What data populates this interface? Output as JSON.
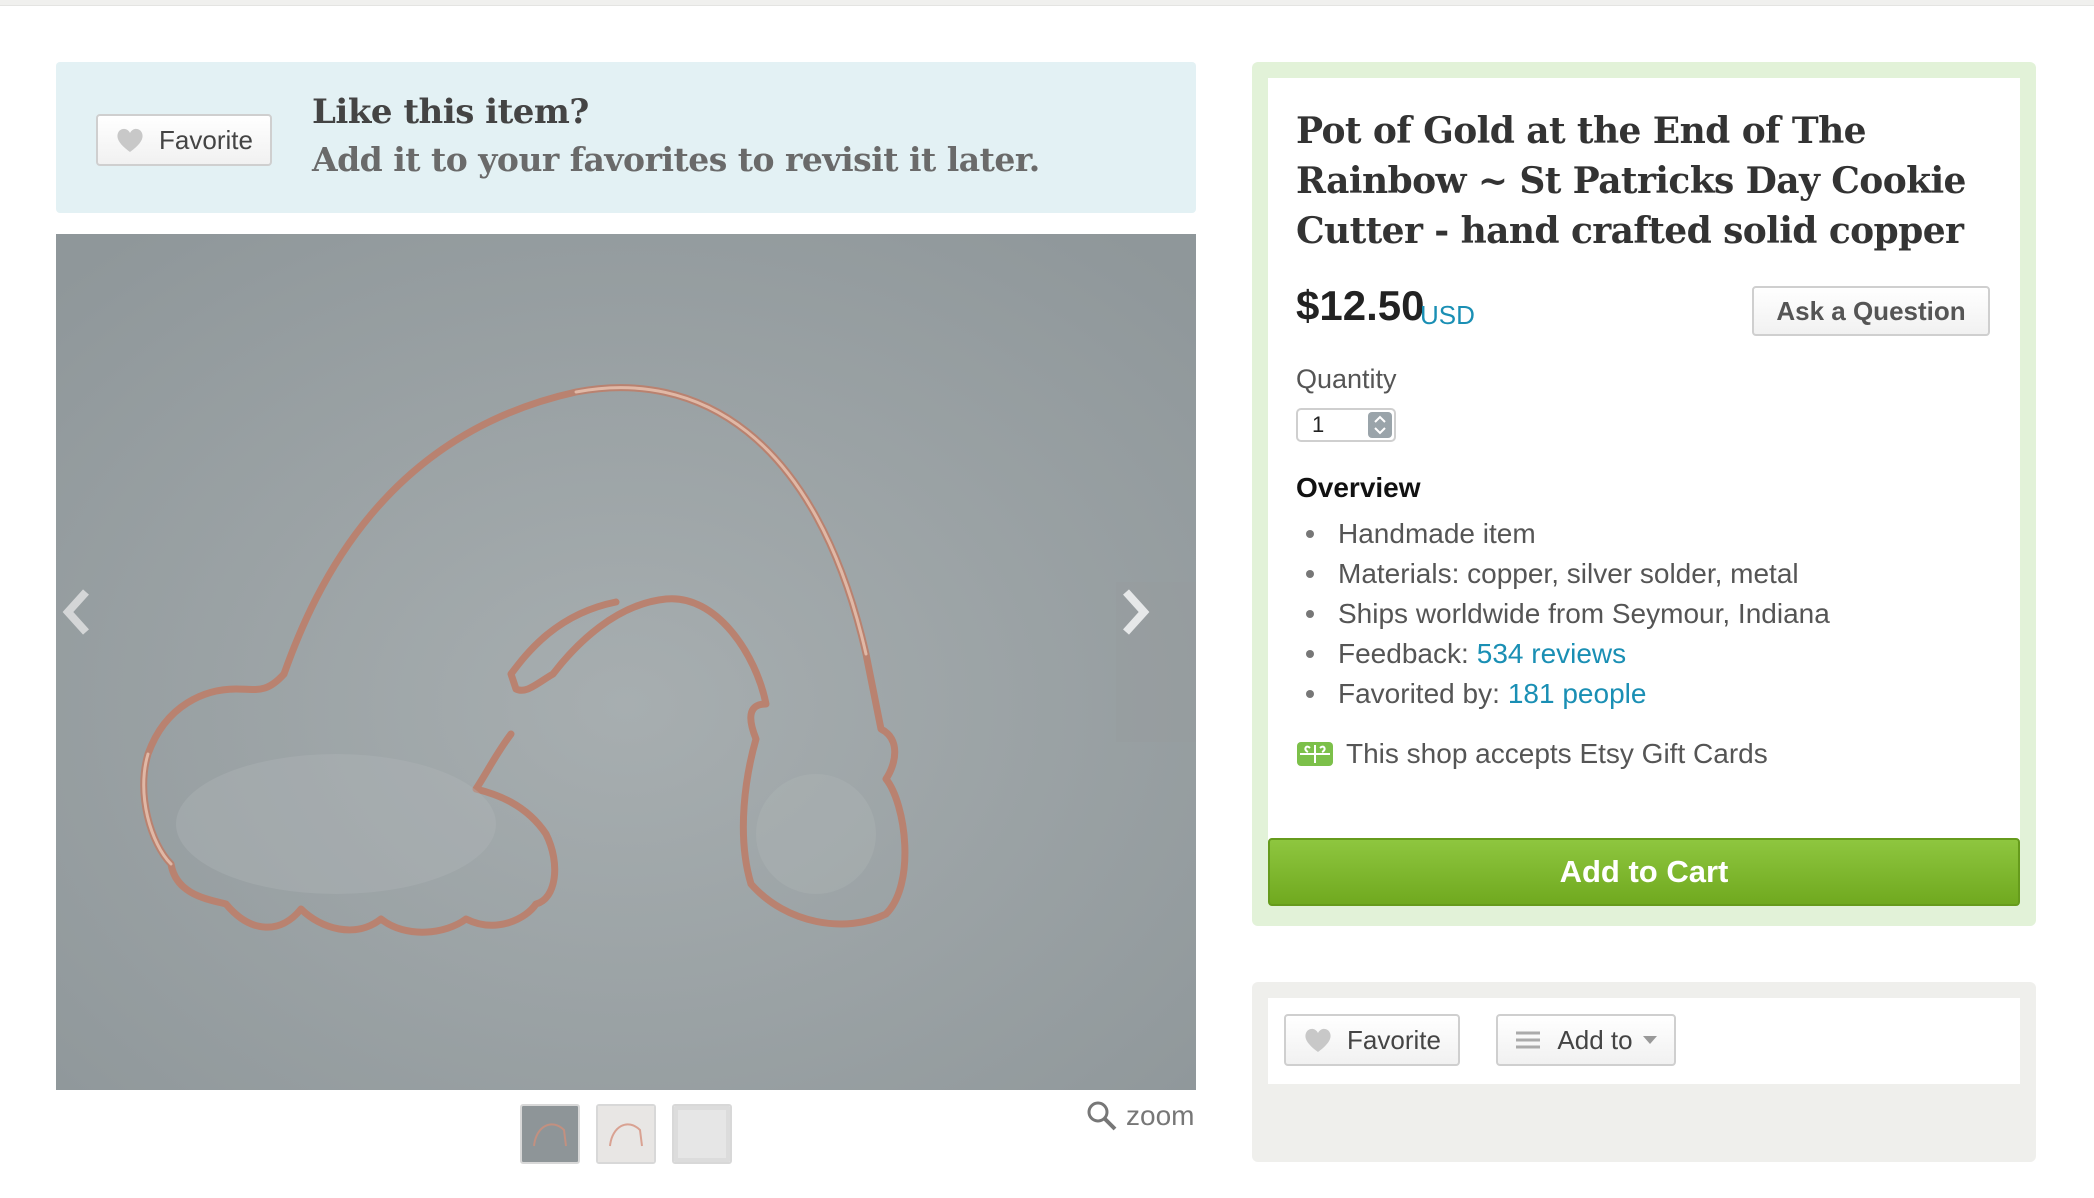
{
  "banner": {
    "favorite_label": "Favorite",
    "title": "Like this item?",
    "subtitle": "Add it to your favorites to revisit it later."
  },
  "gallery": {
    "zoom_label": "zoom",
    "thumbnail_count": 3,
    "background_color": "#9ba2a4",
    "copper_color": "#c8907a"
  },
  "listing": {
    "title": "Pot of Gold at the End of The Rainbow ~ St Patricks Day Cookie Cutter - hand crafted solid copper",
    "price": "$12.50",
    "currency": "USD",
    "ask_label": "Ask a Question",
    "quantity_label": "Quantity",
    "quantity_value": "1",
    "overview_heading": "Overview",
    "overview": {
      "handmade": "Handmade item",
      "materials": "Materials: copper, silver solder, metal",
      "ships": "Ships worldwide from Seymour, Indiana",
      "feedback_prefix": "Feedback:",
      "feedback_link": "534 reviews",
      "favorited_prefix": "Favorited by:",
      "favorited_link": "181 people"
    },
    "gift_text": "This shop accepts Etsy Gift Cards",
    "add_to_cart": "Add to Cart",
    "accent_color": "#7ab929",
    "link_color": "#1a8fb4"
  },
  "actions": {
    "favorite_label": "Favorite",
    "add_to_label": "Add to"
  }
}
